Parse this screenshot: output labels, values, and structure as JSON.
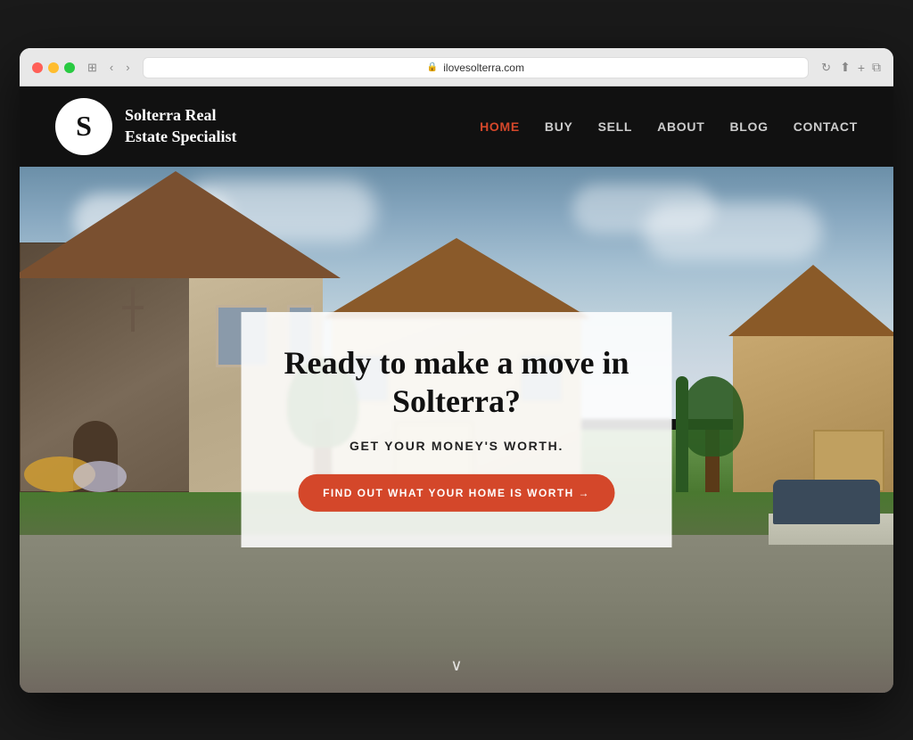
{
  "browser": {
    "url": "ilovesolterra.com",
    "controls": {
      "back": "‹",
      "forward": "›",
      "grid": "⊞",
      "refresh": "↻",
      "share": "⬆",
      "add_tab": "+",
      "tabs": "⧉"
    }
  },
  "site": {
    "logo": {
      "letter": "S",
      "name_line1": "Solterra Real",
      "name_line2": "Estate Specialist"
    },
    "nav": {
      "links": [
        {
          "label": "HOME",
          "active": true
        },
        {
          "label": "BUY",
          "active": false
        },
        {
          "label": "SELL",
          "active": false
        },
        {
          "label": "ABOUT",
          "active": false
        },
        {
          "label": "BLOG",
          "active": false
        },
        {
          "label": "CONTACT",
          "active": false
        }
      ]
    },
    "hero": {
      "title_line1": "Ready to make a move in",
      "title_line2": "Solterra?",
      "subtitle": "GET YOUR MONEY'S WORTH.",
      "cta_label": "FIND OUT WHAT YOUR HOME IS WORTH →",
      "scroll_icon": "∨"
    },
    "colors": {
      "nav_bg": "#111111",
      "accent": "#d4472a",
      "hero_overlay_bg": "rgba(255,255,255,0.88)",
      "text_dark": "#111111",
      "text_nav_inactive": "#cccccc",
      "nav_active": "#d4472a"
    }
  }
}
